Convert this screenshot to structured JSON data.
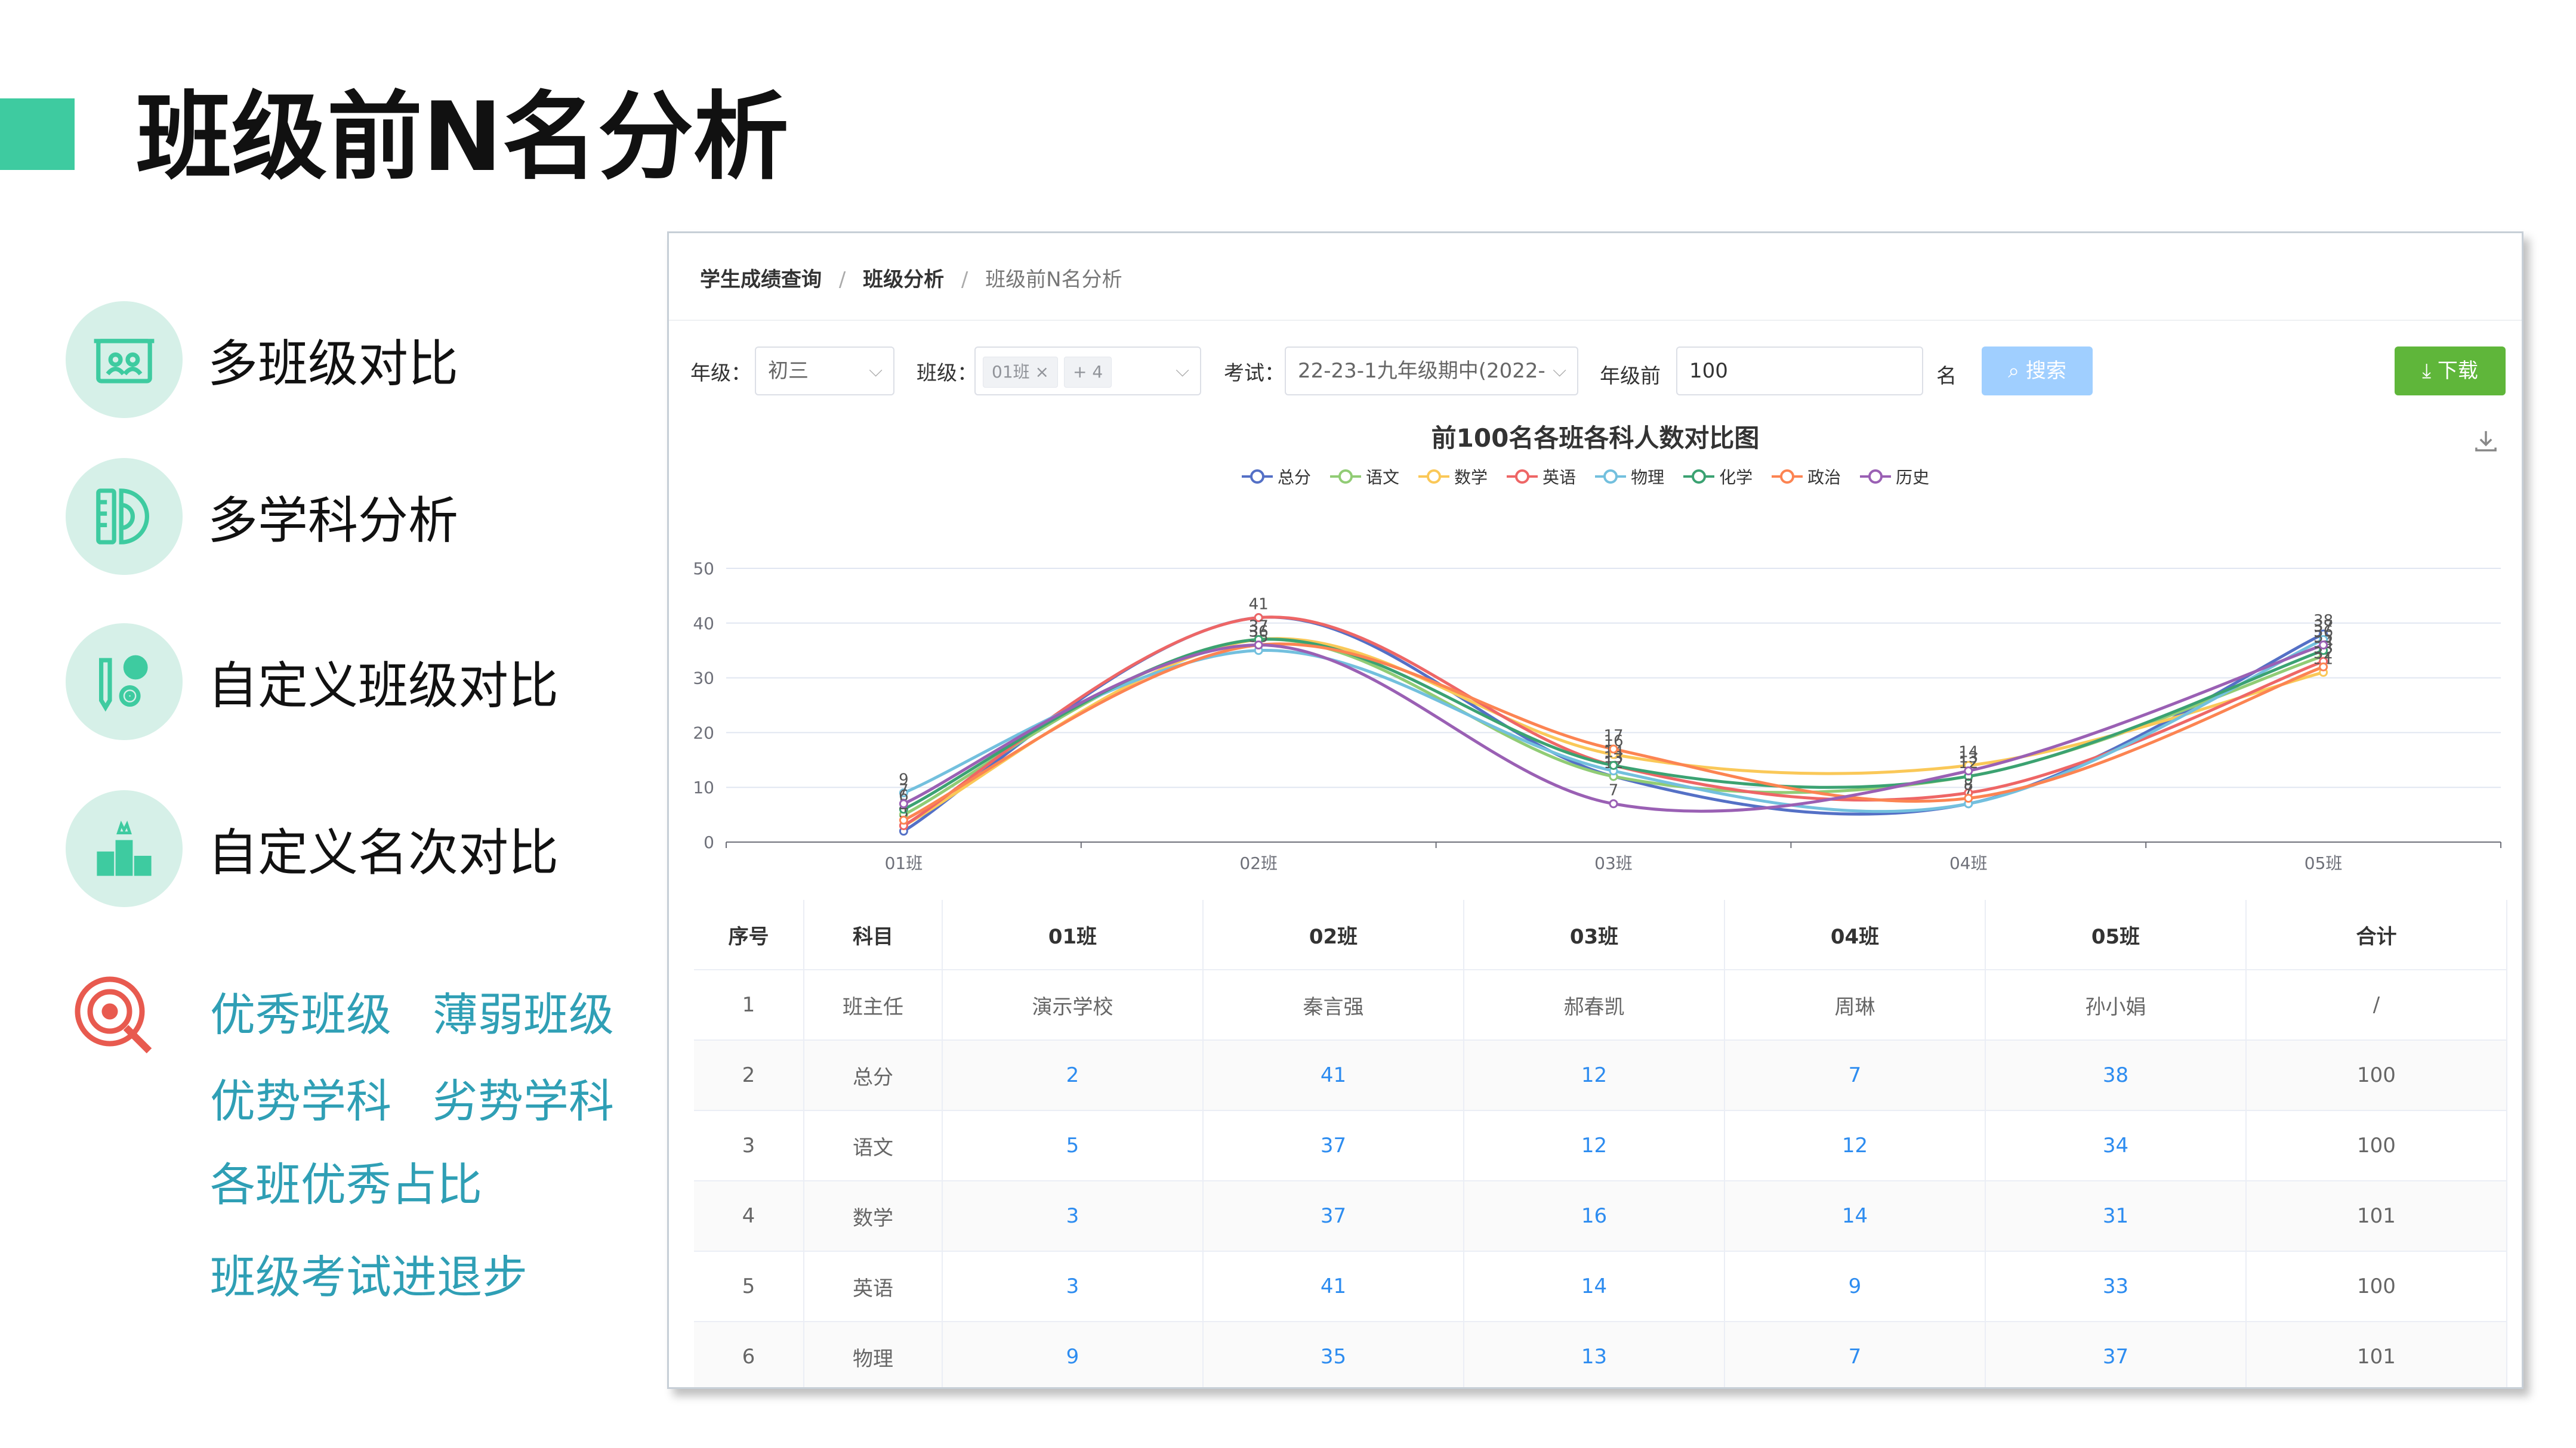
{
  "page": {
    "title": "班级前N名分析"
  },
  "features": [
    {
      "label": "多班级对比",
      "icon": "board-icon"
    },
    {
      "label": "多学科分析",
      "icon": "ruler-protractor-icon"
    },
    {
      "label": "自定义班级对比",
      "icon": "pencil-gear-icon"
    },
    {
      "label": "自定义名次对比",
      "icon": "podium-icon"
    }
  ],
  "tags": {
    "icon": "target-icon",
    "items": [
      "优秀班级",
      "薄弱班级",
      "优势学科",
      "劣势学科",
      "各班优秀占比",
      "班级考试进退步"
    ]
  },
  "app": {
    "breadcrumb": [
      "学生成绩查询",
      "班级分析",
      "班级前N名分析"
    ],
    "filters": {
      "grade_label": "年级：",
      "grade_value": "初三",
      "class_label": "班级：",
      "class_chip": "01班",
      "class_chip_close": "×",
      "class_more": "+ 4",
      "exam_label": "考试：",
      "exam_value": "22-23-1九年级期中(2022-",
      "topn_label": "年级前",
      "topn_value": "100",
      "topn_unit": "名",
      "search_label": "搜索",
      "download_label": "下载"
    },
    "colors": {
      "accent": "#3ecba0",
      "search_button": "#a0cfff",
      "download_button": "#5fb63a",
      "link": "#2d8cf0"
    }
  },
  "chart_data": {
    "type": "line",
    "title": "前100名各班各科人数对比图",
    "categories": [
      "01班",
      "02班",
      "03班",
      "04班",
      "05班"
    ],
    "ylim": [
      0,
      50
    ],
    "yticks": [
      0,
      10,
      20,
      30,
      40,
      50
    ],
    "smooth": true,
    "grid": true,
    "legend_position": "top",
    "series": [
      {
        "name": "总分",
        "color": "#5470c6",
        "values": [
          2,
          41,
          12,
          7,
          38
        ]
      },
      {
        "name": "语文",
        "color": "#91cc75",
        "values": [
          5,
          37,
          12,
          12,
          34
        ]
      },
      {
        "name": "数学",
        "color": "#fac858",
        "values": [
          3,
          37,
          16,
          14,
          31
        ]
      },
      {
        "name": "英语",
        "color": "#ee6666",
        "values": [
          3,
          41,
          14,
          9,
          33
        ]
      },
      {
        "name": "物理",
        "color": "#73c0de",
        "values": [
          9,
          35,
          13,
          7,
          37
        ]
      },
      {
        "name": "化学",
        "color": "#3ba272",
        "values": [
          6,
          37,
          14,
          12,
          35
        ]
      },
      {
        "name": "政治",
        "color": "#fc8452",
        "values": [
          4,
          36,
          17,
          8,
          32
        ]
      },
      {
        "name": "历史",
        "color": "#9a60b4",
        "values": [
          7,
          36,
          7,
          13,
          36
        ]
      }
    ]
  },
  "table": {
    "headers": [
      "序号",
      "科目",
      "01班",
      "02班",
      "03班",
      "04班",
      "05班",
      "合计"
    ],
    "rows": [
      [
        "1",
        "班主任",
        "演示学校",
        "秦言强",
        "郝春凯",
        "周琳",
        "孙小娟",
        "/"
      ],
      [
        "2",
        "总分",
        "2",
        "41",
        "12",
        "7",
        "38",
        "100"
      ],
      [
        "3",
        "语文",
        "5",
        "37",
        "12",
        "12",
        "34",
        "100"
      ],
      [
        "4",
        "数学",
        "3",
        "37",
        "16",
        "14",
        "31",
        "101"
      ],
      [
        "5",
        "英语",
        "3",
        "41",
        "14",
        "9",
        "33",
        "100"
      ],
      [
        "6",
        "物理",
        "9",
        "35",
        "13",
        "7",
        "37",
        "101"
      ]
    ]
  }
}
